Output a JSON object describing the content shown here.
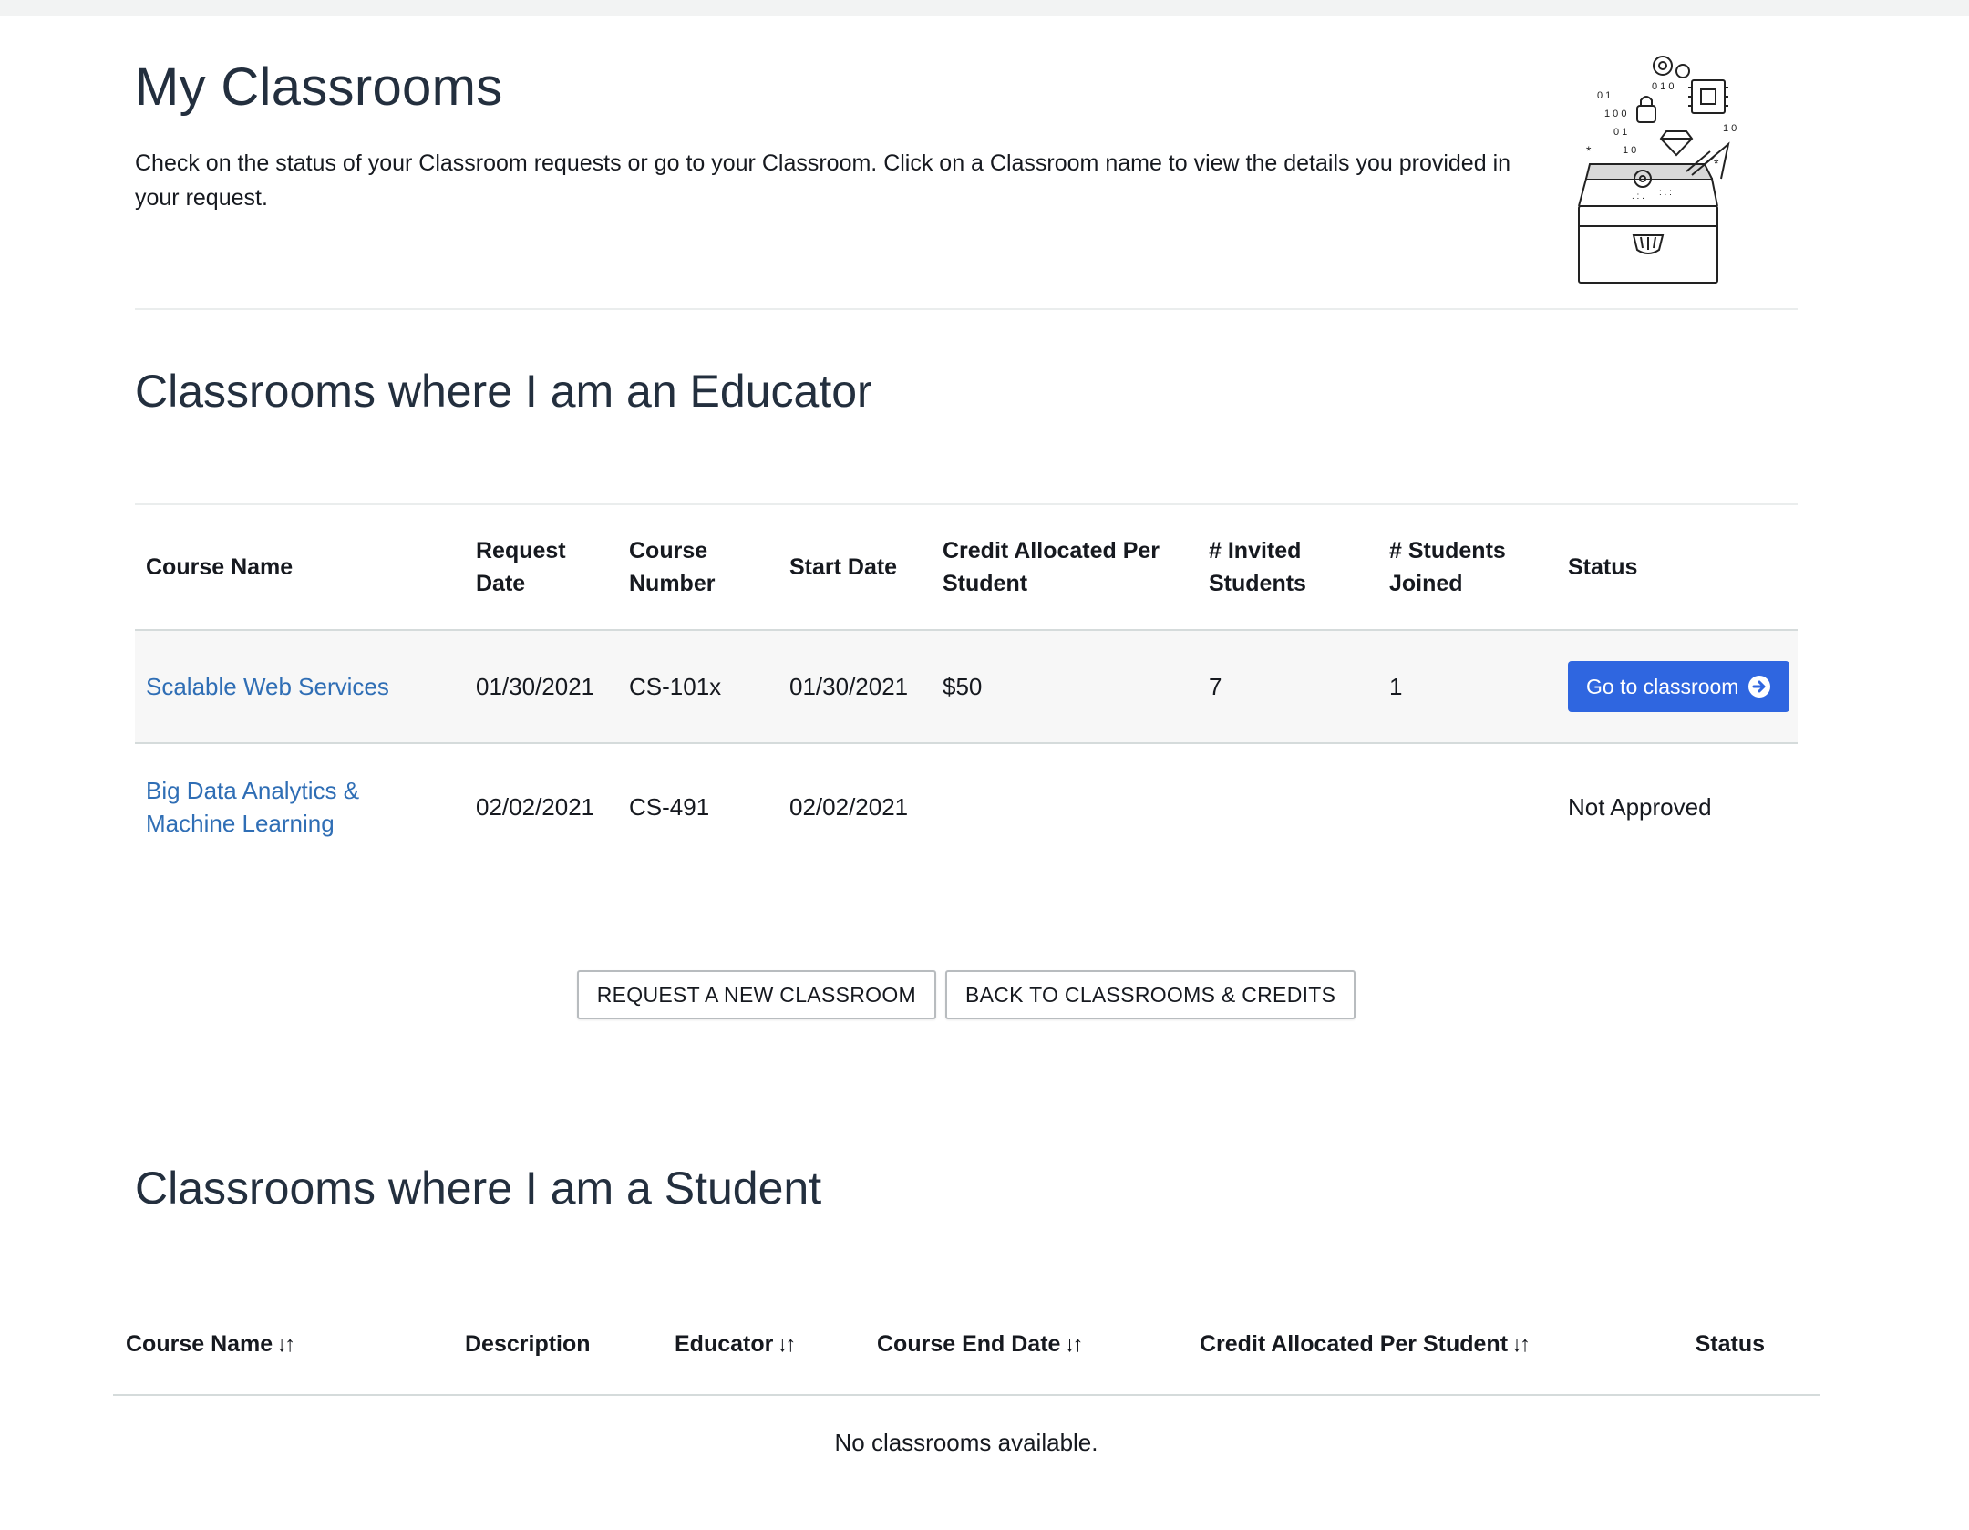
{
  "page": {
    "title": "My Classrooms",
    "intro": "Check on the status of your Classroom requests or go to your Classroom. Click on a Classroom name to view the details you provided in your request."
  },
  "educator": {
    "section_title": "Classrooms where I am an Educator",
    "columns": [
      "Course Name",
      "Request Date",
      "Course Number",
      "Start Date",
      "Credit Allocated Per Student",
      "# Invited Students",
      "# Students Joined",
      "Status"
    ],
    "rows": [
      {
        "course_name": "Scalable Web Services",
        "request_date": "01/30/2021",
        "course_number": "CS-101x",
        "start_date": "01/30/2021",
        "credit": "$50",
        "invited": "7",
        "joined": "1",
        "status_button": "Go to classroom"
      },
      {
        "course_name": "Big Data Analytics & Machine Learning",
        "request_date": "02/02/2021",
        "course_number": "CS-491",
        "start_date": "02/02/2021",
        "credit": "",
        "invited": "",
        "joined": "",
        "status": "Not Approved"
      }
    ]
  },
  "actions": {
    "request_new": "REQUEST A NEW CLASSROOM",
    "back": "BACK TO CLASSROOMS & CREDITS"
  },
  "student": {
    "section_title": "Classrooms where I am a Student",
    "columns": [
      "Course Name",
      "Description",
      "Educator",
      "Course End Date",
      "Credit Allocated Per Student",
      "Status"
    ],
    "sort_icon": "↓↑",
    "empty": "No classrooms available."
  },
  "colors": {
    "primary_button": "#2f66e0",
    "link": "#2f6eb5",
    "text": "#16191f"
  },
  "icons": {
    "go_button": "arrow-circle-right-icon",
    "illustration": "treasure-chest-tech-illustration",
    "sort": "sort-arrows-icon"
  }
}
